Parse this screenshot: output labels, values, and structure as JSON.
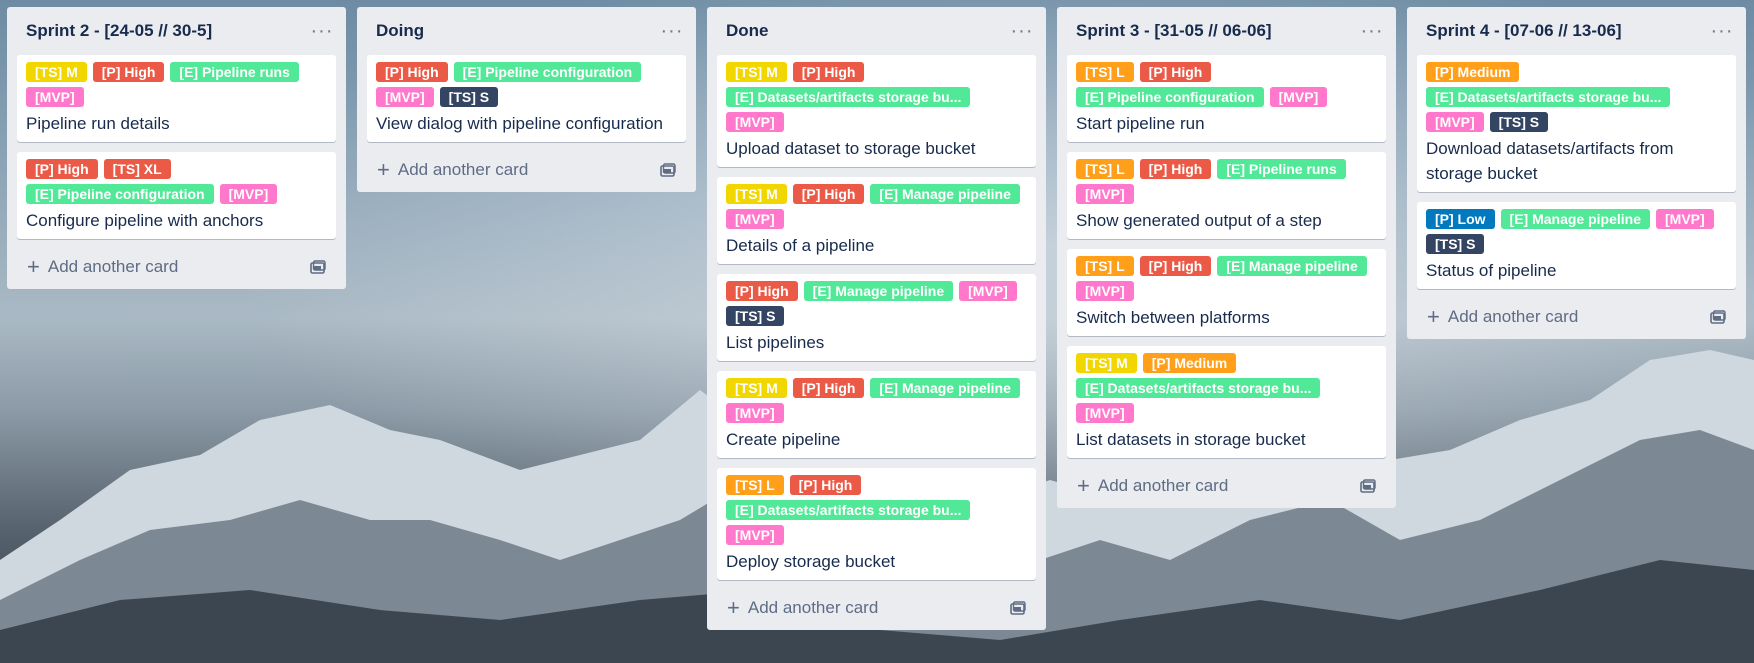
{
  "colors": {
    "yellow": "#f2d600",
    "red": "#eb5a46",
    "green": "#61bd4f",
    "mint": "#51e898",
    "pink": "#ff78cb",
    "navy": "#344563",
    "orange": "#ff9f1a",
    "blue": "#0079bf"
  },
  "common": {
    "add_card_label": "Add another card",
    "menu_glyph": "···",
    "plus_glyph": "+"
  },
  "lists": [
    {
      "title": "Sprint 2 - [24-05 // 30-5]",
      "cards": [
        {
          "title": "Pipeline run details",
          "labels": [
            {
              "text": "[TS] M",
              "color": "yellow"
            },
            {
              "text": "[P] High",
              "color": "red"
            },
            {
              "text": "[E] Pipeline runs",
              "color": "mint"
            },
            {
              "text": "[MVP]",
              "color": "pink"
            }
          ]
        },
        {
          "title": "Configure pipeline with anchors",
          "labels": [
            {
              "text": "[P] High",
              "color": "red"
            },
            {
              "text": "[TS] XL",
              "color": "red"
            },
            {
              "text": "[E] Pipeline configuration",
              "color": "mint"
            },
            {
              "text": "[MVP]",
              "color": "pink"
            }
          ]
        }
      ]
    },
    {
      "title": "Doing",
      "cards": [
        {
          "title": "View dialog with pipeline configuration",
          "labels": [
            {
              "text": "[P] High",
              "color": "red"
            },
            {
              "text": "[E] Pipeline configuration",
              "color": "mint"
            },
            {
              "text": "[MVP]",
              "color": "pink"
            },
            {
              "text": "[TS] S",
              "color": "navy"
            }
          ]
        }
      ]
    },
    {
      "title": "Done",
      "cards": [
        {
          "title": "Upload dataset to storage bucket",
          "labels": [
            {
              "text": "[TS] M",
              "color": "yellow"
            },
            {
              "text": "[P] High",
              "color": "red"
            },
            {
              "text": "[E] Datasets/artifacts storage bu...",
              "color": "mint"
            },
            {
              "text": "[MVP]",
              "color": "pink"
            }
          ]
        },
        {
          "title": "Details of a pipeline",
          "labels": [
            {
              "text": "[TS] M",
              "color": "yellow"
            },
            {
              "text": "[P] High",
              "color": "red"
            },
            {
              "text": "[E] Manage pipeline",
              "color": "mint"
            },
            {
              "text": "[MVP]",
              "color": "pink"
            }
          ]
        },
        {
          "title": "List pipelines",
          "labels": [
            {
              "text": "[P] High",
              "color": "red"
            },
            {
              "text": "[E] Manage pipeline",
              "color": "mint"
            },
            {
              "text": "[MVP]",
              "color": "pink"
            },
            {
              "text": "[TS] S",
              "color": "navy"
            }
          ]
        },
        {
          "title": "Create pipeline",
          "labels": [
            {
              "text": "[TS] M",
              "color": "yellow"
            },
            {
              "text": "[P] High",
              "color": "red"
            },
            {
              "text": "[E] Manage pipeline",
              "color": "mint"
            },
            {
              "text": "[MVP]",
              "color": "pink"
            }
          ]
        },
        {
          "title": "Deploy storage bucket",
          "labels": [
            {
              "text": "[TS] L",
              "color": "orange"
            },
            {
              "text": "[P] High",
              "color": "red"
            },
            {
              "text": "[E] Datasets/artifacts storage bu...",
              "color": "mint"
            },
            {
              "text": "[MVP]",
              "color": "pink"
            }
          ]
        }
      ]
    },
    {
      "title": "Sprint 3 - [31-05 // 06-06]",
      "cards": [
        {
          "title": "Start pipeline run",
          "labels": [
            {
              "text": "[TS] L",
              "color": "orange"
            },
            {
              "text": "[P] High",
              "color": "red"
            },
            {
              "text": "[E] Pipeline configuration",
              "color": "mint"
            },
            {
              "text": "[MVP]",
              "color": "pink"
            }
          ]
        },
        {
          "title": "Show generated output of a step",
          "labels": [
            {
              "text": "[TS] L",
              "color": "orange"
            },
            {
              "text": "[P] High",
              "color": "red"
            },
            {
              "text": "[E] Pipeline runs",
              "color": "mint"
            },
            {
              "text": "[MVP]",
              "color": "pink"
            }
          ]
        },
        {
          "title": "Switch between platforms",
          "labels": [
            {
              "text": "[TS] L",
              "color": "orange"
            },
            {
              "text": "[P] High",
              "color": "red"
            },
            {
              "text": "[E] Manage pipeline",
              "color": "mint"
            },
            {
              "text": "[MVP]",
              "color": "pink"
            }
          ]
        },
        {
          "title": "List datasets in storage bucket",
          "labels": [
            {
              "text": "[TS] M",
              "color": "yellow"
            },
            {
              "text": "[P] Medium",
              "color": "orange"
            },
            {
              "text": "[E] Datasets/artifacts storage bu...",
              "color": "mint"
            },
            {
              "text": "[MVP]",
              "color": "pink"
            }
          ]
        }
      ]
    },
    {
      "title": "Sprint 4 - [07-06 // 13-06]",
      "cards": [
        {
          "title": "Download datasets/artifacts from storage bucket",
          "labels": [
            {
              "text": "[P] Medium",
              "color": "orange"
            },
            {
              "text": "[E] Datasets/artifacts storage bu...",
              "color": "mint"
            },
            {
              "text": "[MVP]",
              "color": "pink"
            },
            {
              "text": "[TS] S",
              "color": "navy"
            }
          ]
        },
        {
          "title": "Status of pipeline",
          "labels": [
            {
              "text": "[P] Low",
              "color": "blue"
            },
            {
              "text": "[E] Manage pipeline",
              "color": "mint"
            },
            {
              "text": "[MVP]",
              "color": "pink"
            },
            {
              "text": "[TS] S",
              "color": "navy"
            }
          ]
        }
      ]
    }
  ]
}
